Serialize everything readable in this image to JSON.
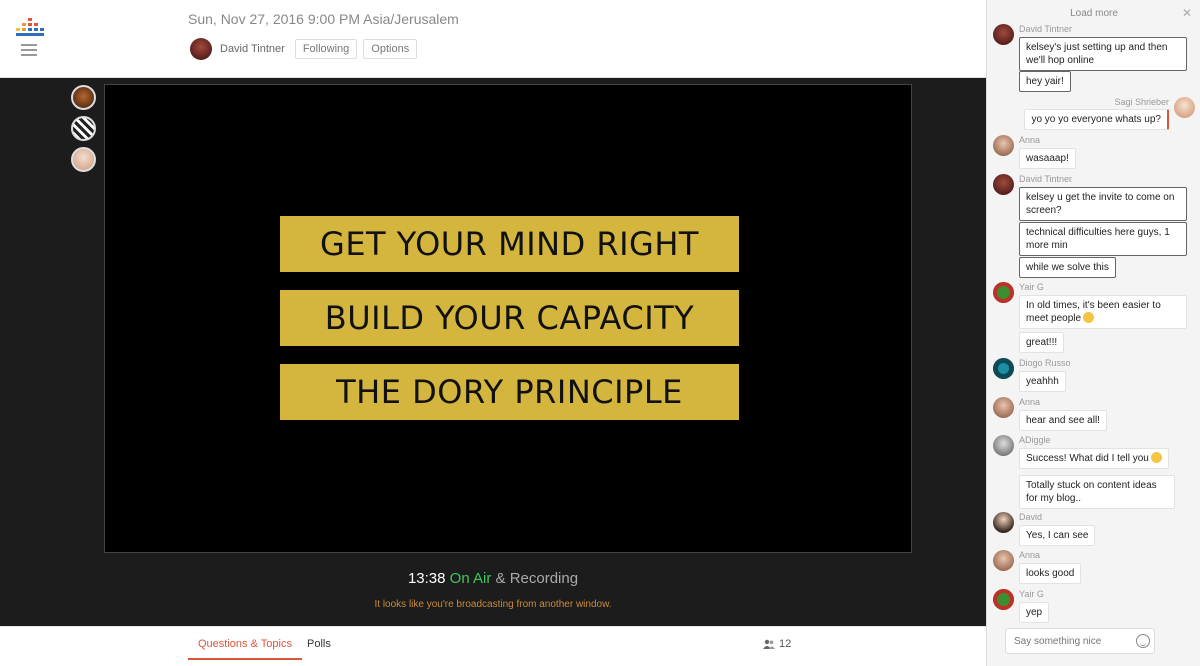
{
  "header": {
    "date": "Sun, Nov 27, 2016 9:00 PM Asia/Jerusalem",
    "host_name": "David Tintner",
    "following_label": "Following",
    "options_label": "Options"
  },
  "slide": {
    "lines": [
      "GET YOUR MIND RIGHT",
      "BUILD YOUR CAPACITY",
      "THE DORY PRINCIPLE"
    ]
  },
  "status": {
    "time": "13:38",
    "on_air": "On Air",
    "recording": "& Recording",
    "note": "It looks like you're broadcasting from another window."
  },
  "tabs": {
    "questions": "Questions & Topics",
    "polls": "Polls",
    "viewer_count": "12"
  },
  "chat": {
    "load_more": "Load more",
    "placeholder": "Say something nice",
    "messages": [
      {
        "author": "David Tintner",
        "texts": [
          "kelsey's just setting up and then we'll hop online",
          "hey yair!"
        ]
      },
      {
        "author": "Sagi Shrieber",
        "texts": [
          "yo yo yo everyone whats up?"
        ]
      },
      {
        "author": "Anna",
        "texts": [
          "wasaaap!"
        ]
      },
      {
        "author": "David Tintner",
        "texts": [
          "kelsey u get the invite to come on screen?",
          "technical difficulties here guys, 1 more min",
          "while we solve this"
        ]
      },
      {
        "author": "Yair G",
        "texts": [
          "In old times, it's been easier to meet people",
          "great!!!"
        ]
      },
      {
        "author": "Diogo Russo",
        "texts": [
          "yeahhh"
        ]
      },
      {
        "author": "Anna",
        "texts": [
          "hear and see all!"
        ]
      },
      {
        "author": "ADiggle",
        "texts": [
          "Success! What did I tell you",
          "Totally stuck on content ideas for my blog.."
        ]
      },
      {
        "author": "David",
        "texts": [
          "Yes, I can see"
        ]
      },
      {
        "author": "Anna",
        "texts": [
          "looks good"
        ]
      },
      {
        "author": "Yair G",
        "texts": [
          "yep"
        ]
      }
    ]
  },
  "colors": {
    "accent": "#d9563b",
    "on_air": "#3fc75a",
    "slide_bar": "#d4b63e"
  }
}
